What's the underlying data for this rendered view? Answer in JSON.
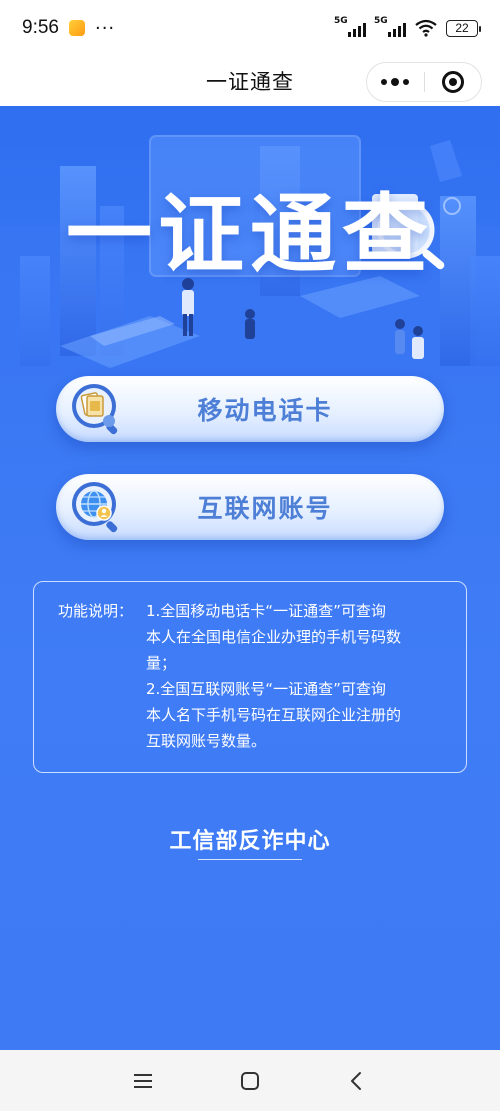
{
  "status_bar": {
    "time": "9:56",
    "dots": "···",
    "signal_1": "5G",
    "signal_2": "5G",
    "battery": "22"
  },
  "title_bar": {
    "title": "一证通查",
    "more_icon": "more-dots-icon",
    "close_icon": "mini-program-close-icon"
  },
  "hero": {
    "title": "一证通查"
  },
  "buttons": {
    "mobile_card": "移动电话卡",
    "internet_account": "互联网账号"
  },
  "info": {
    "heading": "功能说明：",
    "line1": "1.全国移动电话卡“一证通查”可查询",
    "line2": "本人在全国电信企业办理的手机号码数",
    "line3": "量；",
    "line4": "2.全国互联网账号“一证通查”可查询",
    "line5": "本人名下手机号码在互联网企业注册的",
    "line6": "互联网账号数量。"
  },
  "footer": {
    "org": "工信部反诈中心"
  },
  "colors": {
    "main_blue": "#3d7af4",
    "button_text": "#4d7fd6"
  }
}
